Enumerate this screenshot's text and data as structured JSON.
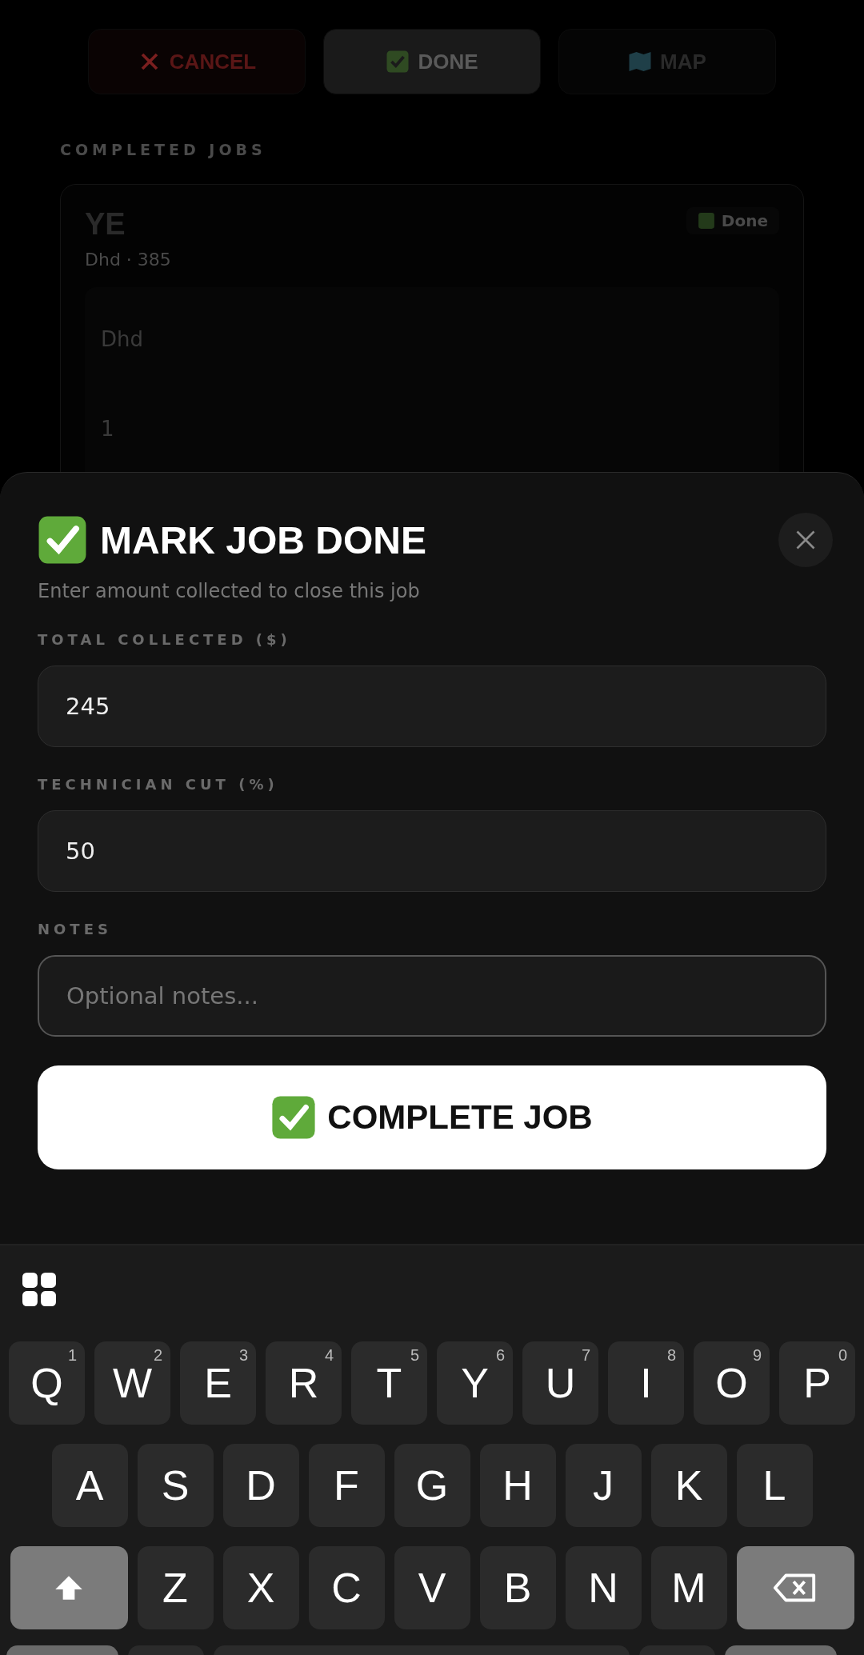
{
  "top_actions": [
    {
      "kind": "cancel",
      "label": "CANCEL"
    },
    {
      "kind": "done",
      "label": "DONE"
    },
    {
      "kind": "map",
      "label": "MAP"
    }
  ],
  "section_title": "COMPLETED JOBS",
  "job": {
    "title": "YE",
    "subtitle": "Dhd · 385",
    "status": "Done",
    "values": [
      "Dhd",
      "1"
    ]
  },
  "modal": {
    "title": "MARK JOB DONE",
    "subtitle": "Enter amount collected to close this job",
    "fields": [
      {
        "label": "TOTAL COLLECTED ($)",
        "value": "245"
      },
      {
        "label": "TECHNICIAN CUT (%)",
        "value": "50"
      },
      {
        "label": "NOTES",
        "placeholder": "Optional notes..."
      }
    ],
    "submit": "COMPLETE JOB"
  },
  "keyboard": {
    "rows": [
      [
        {
          "kind": "letter",
          "key": "Q",
          "hint": "1"
        },
        {
          "kind": "letter",
          "key": "W",
          "hint": "2"
        },
        {
          "kind": "letter",
          "key": "E",
          "hint": "3"
        },
        {
          "kind": "letter",
          "key": "R",
          "hint": "4"
        },
        {
          "kind": "letter",
          "key": "T",
          "hint": "5"
        },
        {
          "kind": "letter",
          "key": "Y",
          "hint": "6"
        },
        {
          "kind": "letter",
          "key": "U",
          "hint": "7"
        },
        {
          "kind": "letter",
          "key": "I",
          "hint": "8"
        },
        {
          "kind": "letter",
          "key": "O",
          "hint": "9"
        },
        {
          "kind": "letter",
          "key": "P",
          "hint": "0"
        }
      ],
      [
        {
          "kind": "letter",
          "key": "A"
        },
        {
          "kind": "letter",
          "key": "S"
        },
        {
          "kind": "letter",
          "key": "D"
        },
        {
          "kind": "letter",
          "key": "F"
        },
        {
          "kind": "letter",
          "key": "G"
        },
        {
          "kind": "letter",
          "key": "H"
        },
        {
          "kind": "letter",
          "key": "J"
        },
        {
          "kind": "letter",
          "key": "K"
        },
        {
          "kind": "letter",
          "key": "L"
        }
      ],
      [
        {
          "kind": "shift"
        },
        {
          "kind": "letter",
          "key": "Z"
        },
        {
          "kind": "letter",
          "key": "X"
        },
        {
          "kind": "letter",
          "key": "C"
        },
        {
          "kind": "letter",
          "key": "V"
        },
        {
          "kind": "letter",
          "key": "B"
        },
        {
          "kind": "letter",
          "key": "N"
        },
        {
          "kind": "letter",
          "key": "M"
        },
        {
          "kind": "backspace"
        }
      ]
    ]
  }
}
